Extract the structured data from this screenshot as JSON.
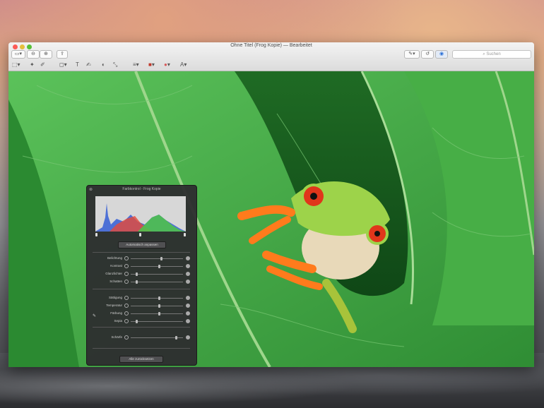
{
  "window": {
    "title": "Ohne Titel (Frog Kopie) — Bearbeitet"
  },
  "toolbar": {
    "search_placeholder": "Suchen",
    "text_tool": "T"
  },
  "inspector": {
    "title": "Farbkontrol - Frog Kopie",
    "auto_button": "Automatisch anpassen",
    "reset_button": "Alle zurücksetzen",
    "rows": [
      {
        "label": "Belichtung",
        "value": 0.6
      },
      {
        "label": "Kontrast",
        "value": 0.55
      },
      {
        "label": "Glanzlichter",
        "value": 0.1
      },
      {
        "label": "Schatten",
        "value": 0.1
      },
      {
        "label": "Sättigung",
        "value": 0.55
      },
      {
        "label": "Temperatur",
        "value": 0.55
      },
      {
        "label": "Färbung",
        "value": 0.55
      },
      {
        "label": "Sepia",
        "value": 0.1
      },
      {
        "label": "Schärfe",
        "value": 0.9
      }
    ]
  },
  "colors": {
    "leaf": "#3fa344",
    "frog_eye": "#e0361b",
    "frog_skin": "#9dd34a",
    "frog_feet": "#ff7b1c"
  }
}
